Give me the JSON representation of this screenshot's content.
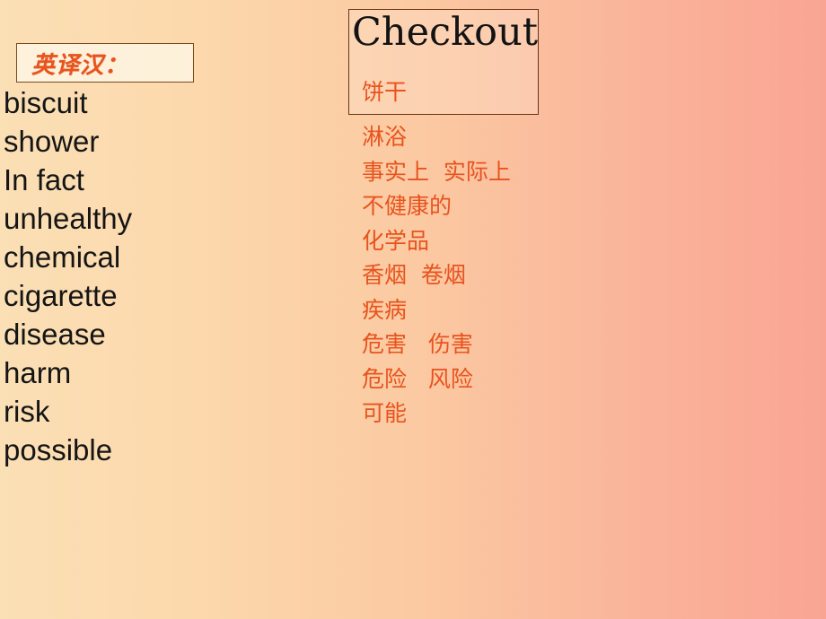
{
  "slide": {
    "background": {
      "gradient_direction": "horizontal-left-to-right",
      "from_color": "#fbdfb5",
      "to_color": "#faa594"
    },
    "accent_color": "#e8531e",
    "text_color": "#151515",
    "border_color": "#6b3414"
  },
  "left_panel": {
    "title": "英译汉：",
    "words": [
      "biscuit",
      "shower",
      "In fact",
      "unhealthy",
      "chemical",
      "cigarette",
      "disease",
      "harm",
      "risk",
      "possible"
    ]
  },
  "right_panel": {
    "heading": "Checkout",
    "first_translation": "饼干",
    "translations": [
      "淋浴",
      "事实上  实际上",
      "不健康的",
      "化学品",
      "香烟  卷烟",
      "疾病",
      "危害   伤害",
      "危险   风险",
      "可能"
    ]
  }
}
